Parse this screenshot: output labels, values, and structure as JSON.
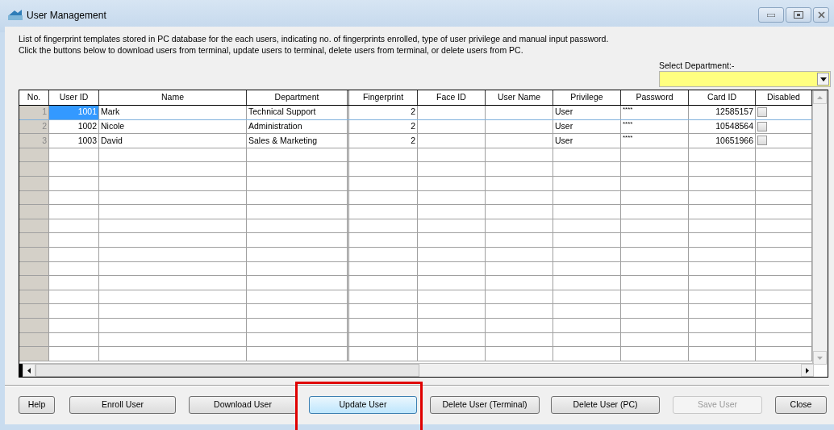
{
  "window": {
    "title": "User Management"
  },
  "description": [
    "List of fingerprint templates stored in PC database for the each users, indicating no. of fingerprints enrolled, type of user privilege and manual input password.",
    "Click the buttons below to download users from terminal, update users to terminal, delete users from terminal, or delete users from PC."
  ],
  "department_filter": {
    "label": "Select Department:-"
  },
  "table": {
    "columns": [
      "No.",
      "User ID",
      "Name",
      "Department",
      "Fingerprint",
      "Face ID",
      "User Name",
      "Privilege",
      "Password",
      "Card ID",
      "Disabled"
    ],
    "rows": [
      {
        "no": "1",
        "user_id": "1001",
        "name": "Mark",
        "department": "Technical Support",
        "fingerprint": "2",
        "privilege": "User",
        "password": "****",
        "card_id": "12585157",
        "disabled": false,
        "selected": true
      },
      {
        "no": "2",
        "user_id": "1002",
        "name": "Nicole",
        "department": "Administration",
        "fingerprint": "2",
        "privilege": "User",
        "password": "****",
        "card_id": "10548564",
        "disabled": false,
        "selected": false
      },
      {
        "no": "3",
        "user_id": "1003",
        "name": "David",
        "department": "Sales & Marketing",
        "fingerprint": "2",
        "privilege": "User",
        "password": "****",
        "card_id": "10651966",
        "disabled": false,
        "selected": false
      }
    ]
  },
  "buttons": [
    {
      "label": "Help",
      "disabled": false,
      "highlighted": false
    },
    {
      "label": "Enroll User",
      "disabled": false,
      "highlighted": false
    },
    {
      "label": "Download User",
      "disabled": false,
      "highlighted": false
    },
    {
      "label": "Update User",
      "disabled": false,
      "highlighted": true
    },
    {
      "label": "Delete User (Terminal)",
      "disabled": false,
      "highlighted": false
    },
    {
      "label": "Delete User (PC)",
      "disabled": false,
      "highlighted": false
    },
    {
      "label": "Save User",
      "disabled": true,
      "highlighted": false
    },
    {
      "label": "Close",
      "disabled": false,
      "highlighted": false
    }
  ]
}
